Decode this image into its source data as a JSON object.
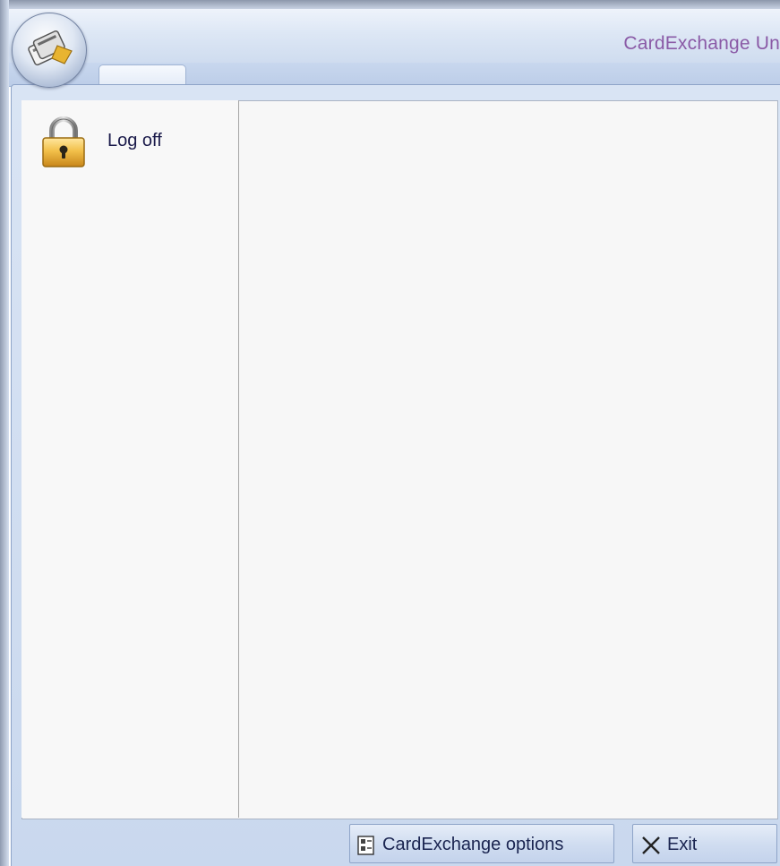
{
  "window": {
    "title": "CardExchange Un"
  },
  "menu": {
    "items": [
      {
        "label": "Log off",
        "icon": "lock-icon"
      }
    ]
  },
  "footer": {
    "options_label": "CardExchange options",
    "options_icon": "options-document-icon",
    "exit_label": "Exit",
    "exit_icon": "close-x-icon"
  },
  "colors": {
    "title_text": "#8a5aa6",
    "panel_background": "#c9d8ee",
    "content_background": "#f7f7f7"
  }
}
